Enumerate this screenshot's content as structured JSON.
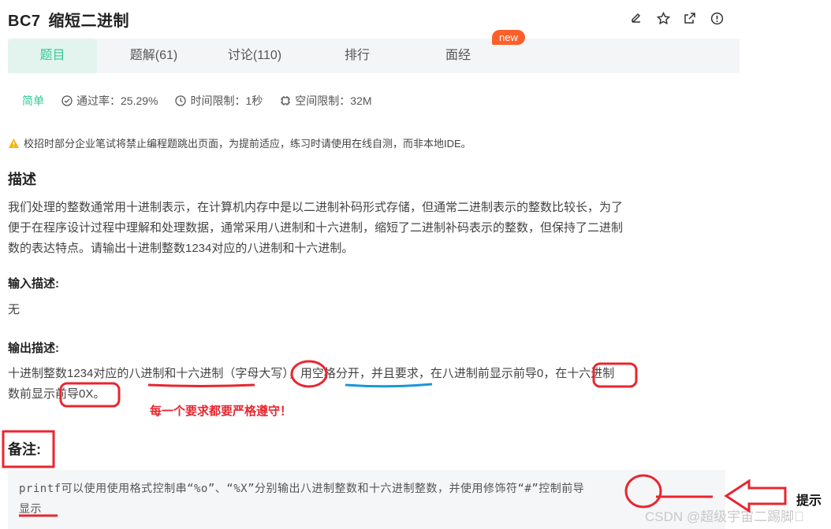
{
  "problem": {
    "code": "BC7",
    "name": "缩短二进制"
  },
  "top_icons": [
    "edit-icon",
    "star-icon",
    "share-icon",
    "report-icon"
  ],
  "tabs": [
    {
      "label": "题目"
    },
    {
      "label": "题解(61)"
    },
    {
      "label": "讨论(110)"
    },
    {
      "label": "排行"
    },
    {
      "label": "面经"
    }
  ],
  "new_badge": "new",
  "meta": {
    "difficulty": "简单",
    "pass_rate": "通过率：25.29%",
    "time_limit": "时间限制：1秒",
    "memory_limit": "空间限制：32M"
  },
  "notice": "校招时部分企业笔试将禁止编程题跳出页面，为提前适应，练习时请使用在线自测，而非本地IDE。",
  "description": {
    "heading": "描述",
    "lines": [
      "我们处理的整数通常用十进制表示，在计算机内存中是以二进制补码形式存储，但通常二进制表示的整数比较长，为了",
      "便于在程序设计过程中理解和处理数据，通常采用八进制和十六进制，缩短了二进制补码表示的整数，但保持了二进制",
      "数的表达特点。请输出十进制整数1234对应的八进制和十六进制。"
    ]
  },
  "input": {
    "heading": "输入描述:",
    "text": "无"
  },
  "output": {
    "heading": "输出描述:",
    "lines": [
      "十进制整数1234对应的八进制和十六进制（字母大写），用空格分开，并且要求，在八进制前显示前导0，在十六进制",
      "数前显示前导0X。"
    ]
  },
  "annotation": {
    "red_note": "每一个要求都要严格遵守！",
    "hint_label": "提示"
  },
  "remark": {
    "heading": "备注:",
    "lines": [
      "printf可以使用使用格式控制串“%o”、“%X”分别输出八进制整数和十六进制整数，并使用修饰符“#”控制前导",
      "显示"
    ]
  },
  "watermark": "CSDN @超级宇宙二踢脚\u0000",
  "colors": {
    "accent": "#32ca99",
    "badge": "#fd5f2a",
    "annotation_red": "#e8262f",
    "annotation_blue": "#1a96d8"
  }
}
